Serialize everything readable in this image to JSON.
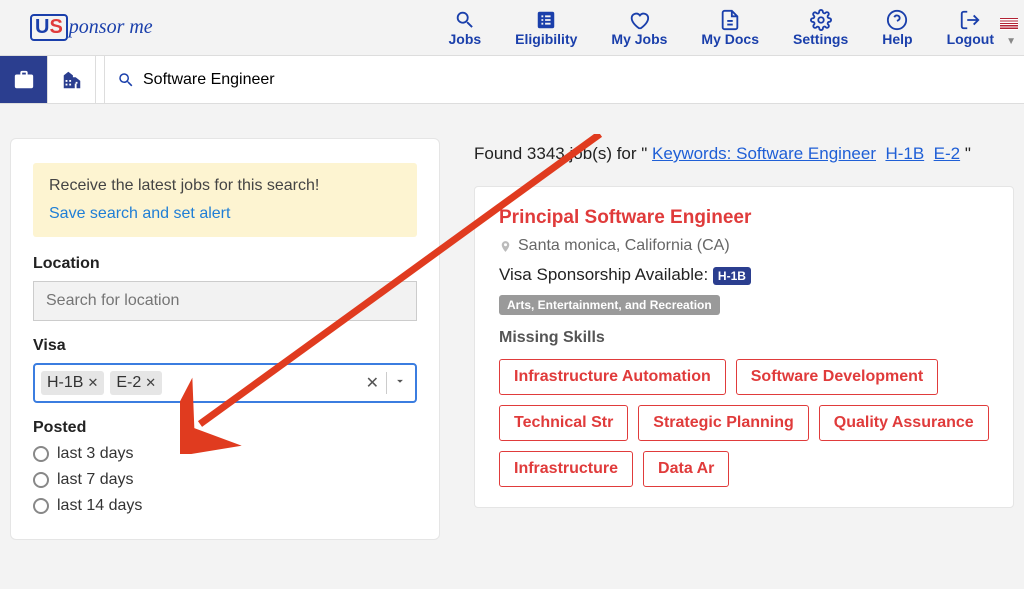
{
  "logo": {
    "prefix_u": "U",
    "prefix_s": "S",
    "rest": "ponsor me"
  },
  "nav": {
    "jobs": "Jobs",
    "eligibility": "Eligibility",
    "myjobs": "My Jobs",
    "mydocs": "My Docs",
    "settings": "Settings",
    "help": "Help",
    "logout": "Logout"
  },
  "search": {
    "value": "Software Engineer"
  },
  "sidebar": {
    "alert_title": "Receive the latest jobs for this search!",
    "alert_link": "Save search and set alert",
    "location_label": "Location",
    "location_placeholder": "Search for location",
    "visa_label": "Visa",
    "visa_chips": [
      "H-1B",
      "E-2"
    ],
    "posted_label": "Posted",
    "posted_options": [
      "last 3 days",
      "last 7 days",
      "last 14 days"
    ]
  },
  "results": {
    "found_prefix": "Found 3343 job(s) for \" ",
    "found_links": [
      "Keywords: Software Engineer",
      "H-1B",
      "E-2"
    ],
    "found_suffix": " \""
  },
  "job": {
    "title": "Principal Software Engineer",
    "location": "Santa monica, California (CA)",
    "sponsor_label": "Visa Sponsorship Available:",
    "sponsor_badge": "H-1B",
    "sector": "Arts, Entertainment, and Recreation",
    "missing_label": "Missing Skills",
    "skills": [
      "Infrastructure Automation",
      "Software Development",
      "Technical Str",
      "Strategic Planning",
      "Quality Assurance",
      "Infrastructure",
      "Data Ar"
    ]
  }
}
